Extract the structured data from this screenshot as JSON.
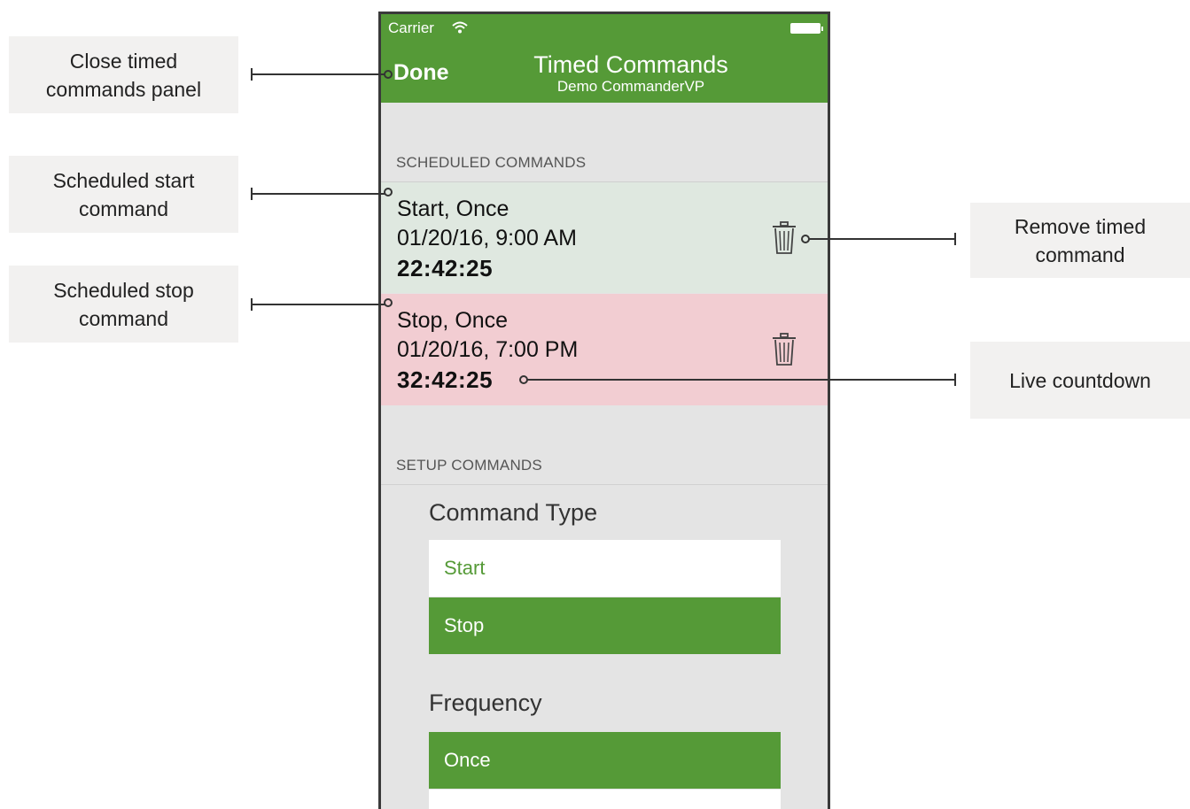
{
  "status_bar": {
    "carrier": "Carrier"
  },
  "navbar": {
    "done_label": "Done",
    "title": "Timed Commands",
    "subtitle": "Demo CommanderVP"
  },
  "scheduled": {
    "header": "SCHEDULED COMMANDS",
    "items": [
      {
        "title": "Start, Once",
        "datetime": "01/20/16, 9:00 AM",
        "countdown": "22:42:25",
        "color": "#dfe8e0"
      },
      {
        "title": "Stop, Once",
        "datetime": "01/20/16, 7:00 PM",
        "countdown": "32:42:25",
        "color": "#f2cdd2"
      }
    ]
  },
  "setup": {
    "header": "SETUP COMMANDS",
    "command_type": {
      "label": "Command Type",
      "options": [
        "Start",
        "Stop"
      ],
      "selected": "Stop"
    },
    "frequency": {
      "label": "Frequency",
      "options": [
        "Once"
      ],
      "selected": "Once"
    }
  },
  "callouts": {
    "done": [
      "Close timed",
      "commands panel"
    ],
    "start": [
      "Scheduled start",
      "command"
    ],
    "stop": [
      "Scheduled stop",
      "command"
    ],
    "trash": [
      "Remove timed",
      "command"
    ],
    "countdown": [
      "Live countdown"
    ]
  },
  "colors": {
    "accent": "#559a37",
    "background": "#e4e4e4",
    "callout_bg": "#f2f1f0"
  },
  "icons": [
    "wifi-icon",
    "battery-icon",
    "trash-icon"
  ]
}
